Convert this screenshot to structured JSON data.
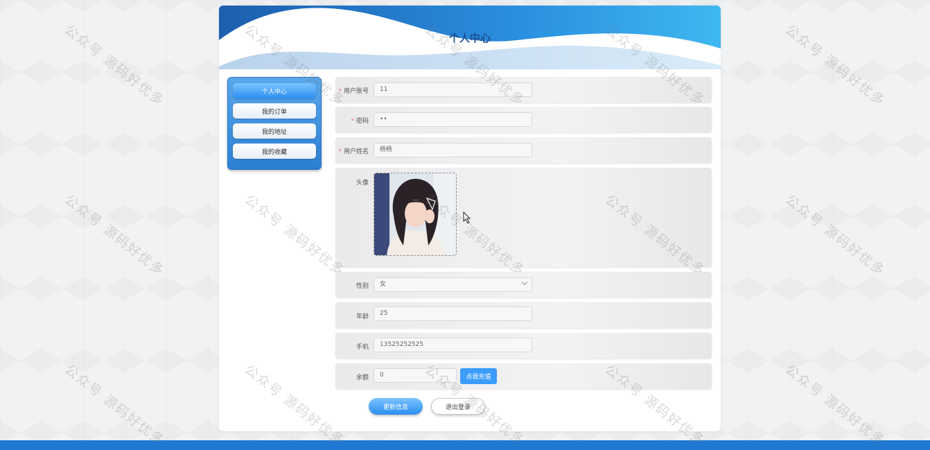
{
  "page": {
    "title": "个人中心"
  },
  "sidebar": {
    "items": [
      {
        "label": "个人中心",
        "active": true
      },
      {
        "label": "我的订单",
        "active": false
      },
      {
        "label": "我的地址",
        "active": false
      },
      {
        "label": "我的收藏",
        "active": false
      }
    ]
  },
  "form": {
    "account": {
      "label": "用户账号",
      "value": "11",
      "required": "*"
    },
    "password": {
      "label": "密码",
      "value": "••",
      "required": "*"
    },
    "name": {
      "label": "用户姓名",
      "value": "杨杨",
      "required": "*"
    },
    "avatar": {
      "label": "头像"
    },
    "gender": {
      "label": "性别",
      "value": "女"
    },
    "age": {
      "label": "年龄",
      "value": "25"
    },
    "phone": {
      "label": "手机",
      "value": "13525252525"
    },
    "balance": {
      "label": "余额",
      "value": "0",
      "recharge_label": "点我充值"
    }
  },
  "actions": {
    "update_label": "更新信息",
    "logout_label": "退出登录"
  },
  "watermark": {
    "text": "公众号 源码好优多"
  },
  "colors": {
    "primary": "#3c9cfa",
    "footer": "#1f78d1",
    "title": "#1e4d92",
    "required": "#f56c6c"
  }
}
